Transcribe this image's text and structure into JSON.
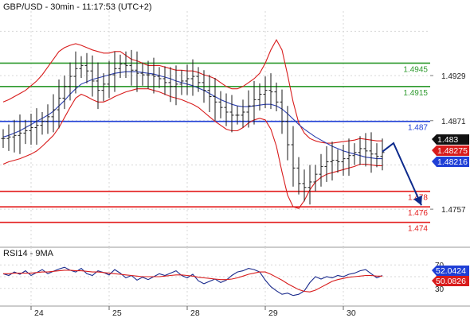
{
  "header": {
    "symbol_timeframe": "GBP/USD - 30min - 11:17:53 (UTC+2)"
  },
  "colors": {
    "price_bars": "#1a1a1a",
    "bollinger": "#d81c1c",
    "moving_average": "#2b3fb0",
    "support_line": "#e31b1b",
    "resistance_line": "#2e9a2e",
    "pivot_line": "#1f3fd6",
    "forecast_arrow": "#0d2a8c",
    "rsi_line": "#1a2a8c",
    "rsi_signal": "#d81c1c",
    "current_price_tag": "#111111",
    "bb_tag": "#d81c1c",
    "ma_tag": "#1f3fd6"
  },
  "chart_data": [
    {
      "type": "line",
      "title": "GBP/USD - 30min - 11:17:53 (UTC+2)",
      "x_tick_labels": [
        "24",
        "25",
        "28",
        "29",
        "30"
      ],
      "y_tick_labels": [
        "1.4929",
        "1.4871",
        "1.4757"
      ],
      "ylim": [
        1.4708,
        1.5012
      ],
      "grid": true,
      "series": [
        {
          "style": "ohlc-bars",
          "close": [
            1.4848,
            1.485,
            1.4852,
            1.4855,
            1.4858,
            1.4862,
            1.4865,
            1.487,
            1.4876,
            1.4885,
            1.49,
            1.4915,
            1.4928,
            1.4938,
            1.4942,
            1.4935,
            1.4922,
            1.491,
            1.4918,
            1.493,
            1.4938,
            1.4944,
            1.4942,
            1.4936,
            1.4932,
            1.493,
            1.493,
            1.4928,
            1.4925,
            1.492,
            1.4915,
            1.4918,
            1.4922,
            1.4925,
            1.4928,
            1.492,
            1.491,
            1.4902,
            1.4895,
            1.4888,
            1.4882,
            1.4878,
            1.4878,
            1.4882,
            1.489,
            1.4898,
            1.4905,
            1.491,
            1.4908,
            1.4895,
            1.487,
            1.484,
            1.481,
            1.479,
            1.4785,
            1.4792,
            1.4802,
            1.4812,
            1.4818,
            1.482,
            1.4818,
            1.4822,
            1.4826,
            1.483,
            1.4835,
            1.4832,
            1.4828,
            1.4825,
            1.483
          ]
        },
        {
          "name": "Bollinger upper",
          "values": [
            1.4895,
            1.4898,
            1.4902,
            1.4906,
            1.491,
            1.4916,
            1.4922,
            1.493,
            1.494,
            1.495,
            1.496,
            1.4965,
            1.4968,
            1.497,
            1.4968,
            1.4965,
            1.4962,
            1.496,
            1.4958,
            1.4958,
            1.496,
            1.496,
            1.4955,
            1.495,
            1.4948,
            1.4945,
            1.4942,
            1.4942,
            1.4942,
            1.494,
            1.4938,
            1.4936,
            1.4936,
            1.4935,
            1.4935,
            1.4933,
            1.493,
            1.4928,
            1.4925,
            1.492,
            1.4915,
            1.4912,
            1.4912,
            1.4915,
            1.492,
            1.4925,
            1.4932,
            1.4945,
            1.4962,
            1.4975,
            1.4962,
            1.493,
            1.4895,
            1.4868,
            1.4855,
            1.4848,
            1.4845,
            1.4843,
            1.4842,
            1.4842,
            1.4843,
            1.4844,
            1.4845,
            1.4846,
            1.4848,
            1.4847,
            1.4846,
            1.4845,
            1.4845
          ]
        },
        {
          "name": "Bollinger lower",
          "values": [
            1.4815,
            1.4818,
            1.482,
            1.4822,
            1.4825,
            1.4828,
            1.4832,
            1.4838,
            1.4845,
            1.4852,
            1.4862,
            1.4875,
            1.4888,
            1.49,
            1.4905,
            1.4902,
            1.4898,
            1.4895,
            1.4895,
            1.4898,
            1.4902,
            1.4905,
            1.4908,
            1.491,
            1.4912,
            1.4912,
            1.4912,
            1.491,
            1.4908,
            1.4905,
            1.4902,
            1.49,
            1.4898,
            1.4895,
            1.4892,
            1.4888,
            1.4882,
            1.4876,
            1.487,
            1.4865,
            1.486,
            1.4858,
            1.4858,
            1.4862,
            1.4868,
            1.4872,
            1.4874,
            1.4872,
            1.486,
            1.4838,
            1.4805,
            1.4775,
            1.476,
            1.4758,
            1.4768,
            1.4782,
            1.4792,
            1.4798,
            1.4802,
            1.4804,
            1.4806,
            1.4808,
            1.481,
            1.4812,
            1.4815,
            1.4815,
            1.4814,
            1.4813,
            1.4813
          ]
        },
        {
          "name": "Moving average",
          "values": [
            1.485,
            1.4852,
            1.4855,
            1.4858,
            1.4862,
            1.4866,
            1.487,
            1.4874,
            1.4878,
            1.4883,
            1.489,
            1.4897,
            1.4905,
            1.4912,
            1.4918,
            1.4921,
            1.4924,
            1.4926,
            1.4928,
            1.493,
            1.4932,
            1.4933,
            1.4934,
            1.4934,
            1.4934,
            1.4933,
            1.4932,
            1.4931,
            1.4929,
            1.4927,
            1.4925,
            1.4922,
            1.492,
            1.4918,
            1.4916,
            1.4913,
            1.491,
            1.4906,
            1.4902,
            1.4898,
            1.4895,
            1.4892,
            1.489,
            1.4889,
            1.4889,
            1.489,
            1.4891,
            1.4892,
            1.4892,
            1.489,
            1.4886,
            1.488,
            1.4873,
            1.4866,
            1.486,
            1.4855,
            1.485,
            1.4846,
            1.4842,
            1.4838,
            1.4835,
            1.4832,
            1.483,
            1.4828,
            1.4826,
            1.4824,
            1.4823,
            1.4822,
            1.4822
          ]
        }
      ],
      "horizontal_levels": [
        {
          "value": 1.4945,
          "label": "1.4945",
          "kind": "resistance"
        },
        {
          "value": 1.4915,
          "label": "1.4915",
          "kind": "resistance"
        },
        {
          "value": 1.487,
          "label": "1.487",
          "kind": "pivot"
        },
        {
          "value": 1.478,
          "label": "1.478",
          "kind": "support"
        },
        {
          "value": 1.476,
          "label": "1.476",
          "kind": "support"
        },
        {
          "value": 1.474,
          "label": "1.474",
          "kind": "support"
        }
      ],
      "price_tags": [
        {
          "label": "1.483",
          "value": 1.483,
          "kind": "price"
        },
        {
          "label": "1.48275",
          "value": 1.48275,
          "kind": "bollinger"
        },
        {
          "label": "1.48216",
          "value": 1.48216,
          "kind": "ma"
        }
      ],
      "forecast_arrow": {
        "points": [
          {
            "bar": 68,
            "value": 1.4831
          },
          {
            "bar": 70,
            "value": 1.4842
          },
          {
            "bar": 75,
            "value": 1.4762
          }
        ]
      }
    },
    {
      "type": "line",
      "title": "RSI14 - 9MA",
      "y_tick_labels": [
        "70",
        "30"
      ],
      "ylim": [
        0,
        100
      ],
      "grid": true,
      "series": [
        {
          "name": "RSI14",
          "values": [
            55,
            52,
            58,
            54,
            60,
            52,
            57,
            62,
            55,
            59,
            63,
            66,
            61,
            58,
            64,
            55,
            52,
            60,
            57,
            53,
            62,
            56,
            48,
            52,
            44,
            49,
            45,
            50,
            55,
            52,
            56,
            60,
            52,
            48,
            54,
            43,
            38,
            42,
            46,
            40,
            44,
            52,
            58,
            60,
            64,
            62,
            58,
            44,
            33,
            26,
            20,
            22,
            18,
            20,
            26,
            40,
            50,
            46,
            50,
            48,
            52,
            50,
            54,
            56,
            60,
            62,
            55,
            48,
            52
          ]
        },
        {
          "name": "9MA",
          "values": [
            55,
            55,
            56,
            56,
            56,
            56,
            57,
            58,
            58,
            59,
            60,
            61,
            61,
            60,
            60,
            59,
            58,
            58,
            57,
            56,
            55,
            54,
            53,
            52,
            51,
            50,
            50,
            50,
            50,
            51,
            52,
            53,
            53,
            52,
            51,
            49,
            48,
            47,
            46,
            45,
            45,
            46,
            48,
            51,
            54,
            56,
            58,
            58,
            54,
            49,
            44,
            38,
            33,
            28,
            25,
            24,
            27,
            32,
            37,
            42,
            45,
            47,
            49,
            50,
            51,
            52,
            52,
            51,
            51
          ]
        }
      ],
      "value_tags": [
        {
          "label": "52.0424",
          "value": 52.0424,
          "kind": "rsi"
        },
        {
          "label": "50.0826",
          "value": 50.0826,
          "kind": "ma"
        }
      ]
    }
  ]
}
